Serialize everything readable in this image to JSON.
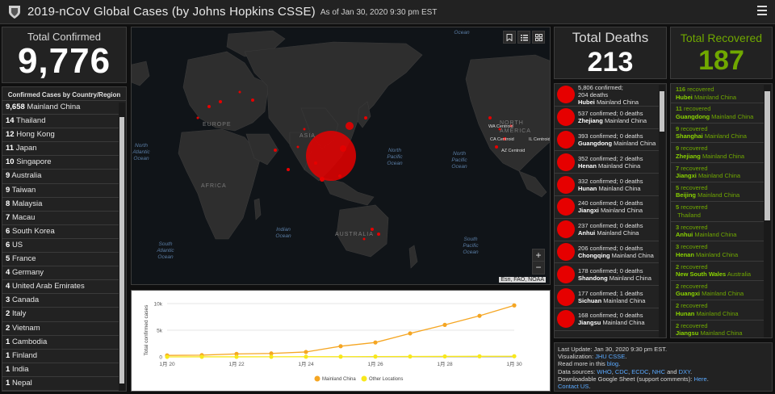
{
  "header": {
    "title": "2019-nCoV Global Cases (by Johns Hopkins CSSE)",
    "as_of": "As of Jan 30, 2020 9:30 pm EST"
  },
  "total_confirmed": {
    "label": "Total Confirmed",
    "value": "9,776"
  },
  "country_list": {
    "title": "Confirmed Cases by Country/Region",
    "items": [
      {
        "num": "9,658",
        "name": "Mainland China"
      },
      {
        "num": "14",
        "name": "Thailand"
      },
      {
        "num": "12",
        "name": "Hong Kong"
      },
      {
        "num": "11",
        "name": "Japan"
      },
      {
        "num": "10",
        "name": "Singapore"
      },
      {
        "num": "9",
        "name": "Australia"
      },
      {
        "num": "9",
        "name": "Taiwan"
      },
      {
        "num": "8",
        "name": "Malaysia"
      },
      {
        "num": "7",
        "name": "Macau"
      },
      {
        "num": "6",
        "name": "South Korea"
      },
      {
        "num": "6",
        "name": "US"
      },
      {
        "num": "5",
        "name": "France"
      },
      {
        "num": "4",
        "name": "Germany"
      },
      {
        "num": "4",
        "name": "United Arab Emirates"
      },
      {
        "num": "3",
        "name": "Canada"
      },
      {
        "num": "2",
        "name": "Italy"
      },
      {
        "num": "2",
        "name": "Vietnam"
      },
      {
        "num": "1",
        "name": "Cambodia"
      },
      {
        "num": "1",
        "name": "Finland"
      },
      {
        "num": "1",
        "name": "India"
      },
      {
        "num": "1",
        "name": "Nepal"
      }
    ]
  },
  "map": {
    "labels": {
      "europe": "EUROPE",
      "asia": "ASIA",
      "africa": "AFRICA",
      "australia": "AUSTRALIA",
      "north_america_1": "NORTH",
      "north_america_2": "AMERICA",
      "ocean_top": "Ocean",
      "na_ocean_1": "North",
      "na_ocean_2": "Atlantic",
      "na_ocean_3": "Ocean",
      "np_ocean_1": "North",
      "np_ocean_2": "Pacific",
      "np_ocean_3": "Ocean",
      "np2_ocean_1": "North",
      "np2_ocean_2": "Pacific",
      "np2_ocean_3": "Ocean",
      "indian_1": "Indian",
      "indian_2": "Ocean",
      "sa_ocean_1": "South",
      "sa_ocean_2": "Atlantic",
      "sa_ocean_3": "Ocean",
      "sp_ocean_1": "South",
      "sp_ocean_2": "Pacific",
      "sp_ocean_3": "Ocean",
      "wa": "WA Centroid",
      "il": "IL Centroid",
      "ca": "CA Centroid",
      "az": "AZ Centroid"
    },
    "zoom_in": "+",
    "zoom_out": "−",
    "attribution": "Esri, FAO, NOAA",
    "colors": {
      "case_dot": "#e60000",
      "land": "#2e2e2e",
      "water": "#101418"
    }
  },
  "chart_data": {
    "type": "line",
    "x": [
      "1月 20",
      "1月 21",
      "1月 22",
      "1月 23",
      "1月 24",
      "1月 25",
      "1月 26",
      "1月 27",
      "1月 28",
      "1月 29",
      "1月 30"
    ],
    "tick_labels": [
      "1月 20",
      "1月 22",
      "1月 24",
      "1月 26",
      "1月 28",
      "1月 30"
    ],
    "ylabel": "Total confirmed cases",
    "yticks": [
      "0",
      "5k",
      "10k"
    ],
    "ylim": [
      0,
      10000
    ],
    "series": [
      {
        "name": "Mainland China",
        "color": "#f5a623",
        "values": [
          278,
          326,
          547,
          639,
          916,
          2000,
          2700,
          4400,
          6000,
          7700,
          9658
        ]
      },
      {
        "name": "Other Locations",
        "color": "#f8e81c",
        "values": [
          4,
          6,
          8,
          14,
          25,
          40,
          57,
          64,
          87,
          105,
          118
        ]
      }
    ]
  },
  "total_deaths": {
    "label": "Total Deaths",
    "value": "213"
  },
  "total_recovered": {
    "label": "Total Recovered",
    "value": "187"
  },
  "deaths_list": [
    {
      "stats": "5,806 confirmed;",
      "stats2": "204 deaths",
      "region": "Hubei",
      "country": "Mainland China"
    },
    {
      "stats": "537 confirmed; 0 deaths",
      "stats2": "",
      "region": "Zhejiang",
      "country": "Mainland China"
    },
    {
      "stats": "393 confirmed; 0 deaths",
      "stats2": "",
      "region": "Guangdong",
      "country": "Mainland China"
    },
    {
      "stats": "352 confirmed; 2 deaths",
      "stats2": "",
      "region": "Henan",
      "country": "Mainland China"
    },
    {
      "stats": "332 confirmed; 0 deaths",
      "stats2": "",
      "region": "Hunan",
      "country": "Mainland China"
    },
    {
      "stats": "240 confirmed; 0 deaths",
      "stats2": "",
      "region": "Jiangxi",
      "country": "Mainland China"
    },
    {
      "stats": "237 confirmed; 0 deaths",
      "stats2": "",
      "region": "Anhui",
      "country": "Mainland China"
    },
    {
      "stats": "206 confirmed; 0 deaths",
      "stats2": "",
      "region": "Chongqing",
      "country": "Mainland China"
    },
    {
      "stats": "178 confirmed; 0 deaths",
      "stats2": "",
      "region": "Shandong",
      "country": "Mainland China"
    },
    {
      "stats": "177 confirmed; 1 deaths",
      "stats2": "",
      "region": "Sichuan",
      "country": "Mainland China"
    },
    {
      "stats": "168 confirmed; 0 deaths",
      "stats2": "",
      "region": "Jiangsu",
      "country": "Mainland China"
    }
  ],
  "recovered_list": [
    {
      "count": "116",
      "suffix": " recovered",
      "region": "Hubei",
      "country": "Mainland China"
    },
    {
      "count": "11",
      "suffix": " recovered",
      "region": "Guangdong",
      "country": "Mainland China"
    },
    {
      "count": "9",
      "suffix": " recovered",
      "region": "Shanghai",
      "country": "Mainland China"
    },
    {
      "count": "9",
      "suffix": " recovered",
      "region": "Zhejiang",
      "country": "Mainland China"
    },
    {
      "count": "7",
      "suffix": " recovered",
      "region": "Jiangxi",
      "country": "Mainland China"
    },
    {
      "count": "5",
      "suffix": " recovered",
      "region": "Beijing",
      "country": "Mainland China"
    },
    {
      "count": "5",
      "suffix": " recovered",
      "region": "",
      "country": "Thailand"
    },
    {
      "count": "3",
      "suffix": " recovered",
      "region": "Anhui",
      "country": "Mainland China"
    },
    {
      "count": "3",
      "suffix": " recovered",
      "region": "Henan",
      "country": "Mainland China"
    },
    {
      "count": "2",
      "suffix": " recovered",
      "region": "New South Wales",
      "country": "Australia"
    },
    {
      "count": "2",
      "suffix": " recovered",
      "region": "Guangxi",
      "country": "Mainland China"
    },
    {
      "count": "2",
      "suffix": " recovered",
      "region": "Hunan",
      "country": "Mainland China"
    },
    {
      "count": "2",
      "suffix": " recovered",
      "region": "Jiangsu",
      "country": "Mainland China"
    }
  ],
  "info": {
    "last_update": "Last Update: Jan 30, 2020 9:30 pm EST.",
    "visualization_prefix": "Visualization: ",
    "visualization_link": "JHU CSSE",
    "visualization_suffix": ".",
    "read_more_prefix": "Read more in this ",
    "read_more_link": "blog",
    "read_more_suffix": ".",
    "sources_prefix": "Data sources: ",
    "src_who": "WHO",
    "src_cdc": "CDC",
    "src_ecdc": "ECDC",
    "src_nhc": "NHC",
    "src_dxy": "DXY",
    "sep": ", ",
    "and": " and ",
    "sources_suffix": ".",
    "sheet_prefix": "Downloadable Google Sheet (support comments): ",
    "sheet_link": "Here",
    "sheet_suffix": ".",
    "contact_link": "Contact US",
    "contact_suffix": "."
  }
}
